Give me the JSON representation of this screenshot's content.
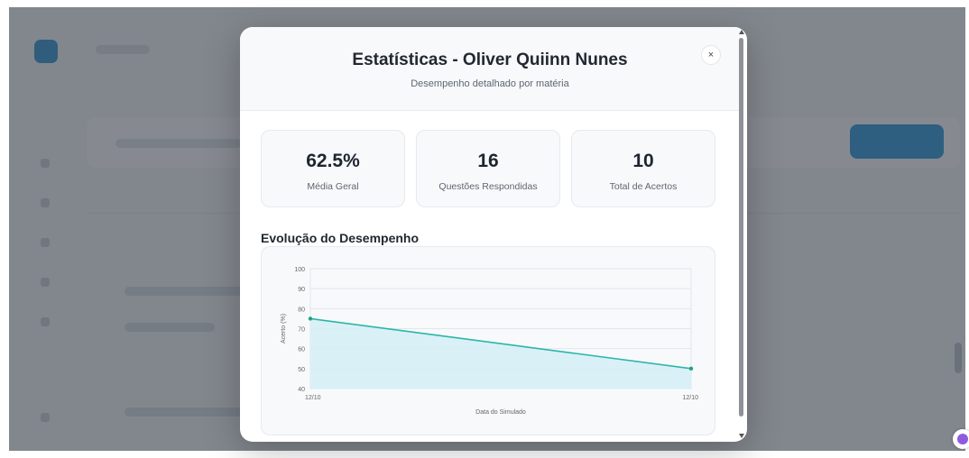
{
  "modal": {
    "title": "Estatísticas - Oliver Quiinn Nunes",
    "subtitle": "Desempenho detalhado por matéria",
    "close_label": "×"
  },
  "stats": [
    {
      "value": "62.5%",
      "label": "Média Geral"
    },
    {
      "value": "16",
      "label": "Questões Respondidas"
    },
    {
      "value": "10",
      "label": "Total de Acertos"
    }
  ],
  "section": {
    "title": "Evolução do Desempenho"
  },
  "chart_data": {
    "type": "area",
    "x": [
      "12/10",
      "12/10"
    ],
    "series": [
      {
        "values": [
          75,
          50
        ]
      }
    ],
    "xlabel": "Data do Simulado",
    "ylabel": "Acerto (%)",
    "ylim": [
      40,
      100
    ],
    "yticks": [
      40,
      50,
      60,
      70,
      80,
      90,
      100
    ],
    "grid": true,
    "colors": {
      "line": "#2bb5a8",
      "fill": "#d3eef6",
      "point": "#1fa37f"
    }
  }
}
